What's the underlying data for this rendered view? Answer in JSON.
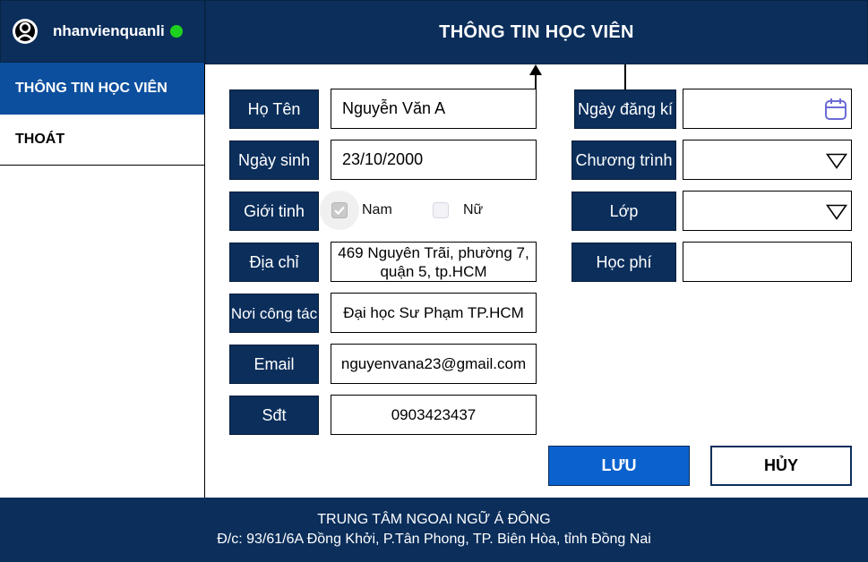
{
  "user": {
    "username": "nhanvienquanli",
    "avatar_icon": "user-avatar-icon",
    "status_color": "#1fd11f"
  },
  "sidebar": {
    "items": [
      {
        "label": "THÔNG TIN HỌC VIÊN",
        "active": true
      },
      {
        "label": "THOÁT",
        "active": false
      }
    ]
  },
  "header": {
    "title": "THÔNG TIN HỌC VIÊN"
  },
  "form": {
    "ho_ten": {
      "label": "Họ Tên",
      "value": "Nguyễn Văn A"
    },
    "ngay_sinh": {
      "label": "Ngày sinh",
      "value": "23/10/2000"
    },
    "gioi_tinh": {
      "label": "Giới tinh",
      "options": [
        "Nam",
        "Nữ"
      ],
      "selected": "Nam"
    },
    "dia_chi": {
      "label": "Địa chỉ",
      "value": "469 Nguyên Trãi, phường 7, quận 5, tp.HCM"
    },
    "noi_cong_tac": {
      "label": "Nơi công tác",
      "value": "Đại học Sư Phạm TP.HCM"
    },
    "email": {
      "label": "Email",
      "value": "nguyenvana23@gmail.com"
    },
    "sdt": {
      "label": "Sđt",
      "value": "0903423437"
    },
    "ngay_dang_ki": {
      "label": "Ngày đăng kí",
      "value": "",
      "icon": "calendar-icon"
    },
    "chuong_trinh": {
      "label": "Chương trình",
      "value": "",
      "icon": "dropdown-triangle-icon"
    },
    "lop": {
      "label": "Lớp",
      "value": "",
      "icon": "dropdown-triangle-icon"
    },
    "hoc_phi": {
      "label": "Học phí",
      "value": ""
    }
  },
  "actions": {
    "save_label": "LƯU",
    "cancel_label": "HỦY"
  },
  "footer": {
    "line1": "TRUNG TÂM NGOAI NGỮ Á ĐÔNG",
    "line2": "Đ/c: 93/61/6A Đồng Khởi, P.Tân Phong, TP. Biên Hòa, tỉnh Đồng Nai"
  },
  "colors": {
    "navy": "#0b2e5b",
    "active_blue": "#0c4f9e",
    "save_blue": "#0b62cf",
    "calendar_icon": "#6b6bd6"
  }
}
